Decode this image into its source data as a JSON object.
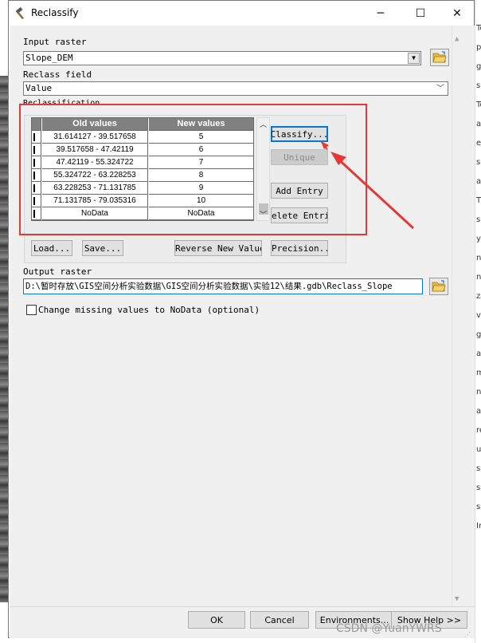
{
  "window": {
    "title": "Reclassify",
    "controls": {
      "minimize": "─",
      "maximize": "☐",
      "close": "✕"
    }
  },
  "input_raster": {
    "label": "Input raster",
    "value": "Slope_DEM"
  },
  "reclass_field": {
    "label": "Reclass field",
    "value": "Value"
  },
  "reclassification": {
    "label": "Reclassification",
    "columns": [
      "Old values",
      "New values"
    ],
    "rows": [
      [
        "31.614127 - 39.517658",
        "5"
      ],
      [
        "39.517658 - 47.42119",
        "6"
      ],
      [
        "47.42119 - 55.324722",
        "7"
      ],
      [
        "55.324722 - 63.228253",
        "8"
      ],
      [
        "63.228253 - 71.131785",
        "9"
      ],
      [
        "71.131785 - 79.035316",
        "10"
      ],
      [
        "NoData",
        "NoData"
      ]
    ],
    "buttons": {
      "classify": "Classify...",
      "unique": "Unique",
      "add_entry": "Add Entry",
      "delete_entries": "elete Entrie"
    }
  },
  "bottom_buttons": {
    "load": "Load...",
    "save": "Save...",
    "reverse": "Reverse New Values",
    "precision": "Precision..."
  },
  "output_raster": {
    "label": "Output raster",
    "value": "D:\\暂时存放\\GIS空间分析实验数据\\GIS空间分析实验数据\\实验12\\结果.gdb\\Reclass_Slope"
  },
  "change_missing": {
    "label": "Change missing values to NoData (optional)",
    "checked": false
  },
  "dialog_buttons": {
    "ok": "OK",
    "cancel": "Cancel",
    "environments": "Environments...",
    "show_help": "Show Help >>"
  },
  "watermark": "CSDN @YuanYWRS",
  "background_right_glyphs": [
    "Tc",
    "pe",
    "ge",
    "s",
    "Tc",
    "al",
    "e",
    "sic",
    "al",
    "T",
    "s",
    "ys",
    "na",
    "n",
    "za",
    "va",
    "gy",
    "ar",
    "m",
    "ne",
    "ar",
    "re",
    "up",
    "ss",
    "ss",
    "ss",
    "Im"
  ],
  "colors": {
    "annotation_red": "#e53935",
    "focus_blue": "#0078d7",
    "header_gray": "#808080"
  }
}
